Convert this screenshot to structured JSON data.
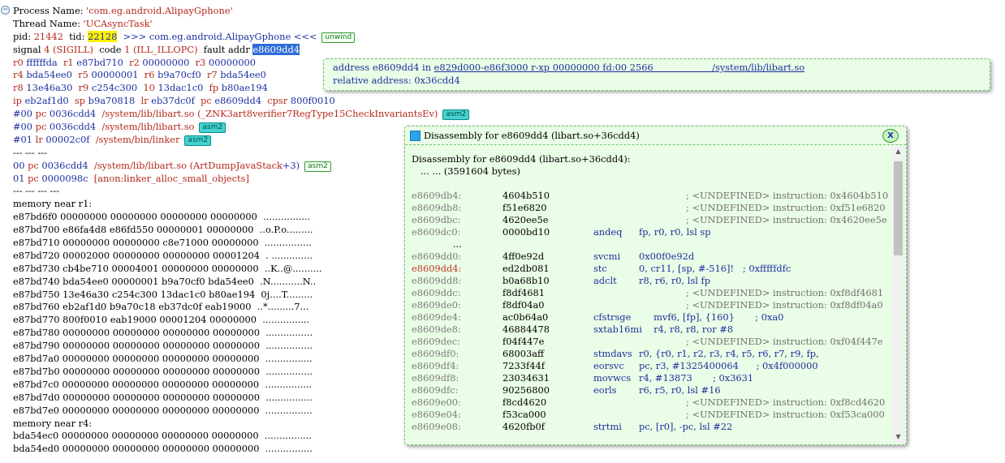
{
  "log": {
    "process_label": "Process Name: ",
    "process_name": "'com.eg.android.AlipayGphone'",
    "thread_label": "Thread Name: ",
    "thread_name": "'UCAsyncTask'",
    "pid_label": "pid: ",
    "pid": "21442",
    "tid_label": "  tid: ",
    "tid": "22128",
    "proc_marker": "  >>> com.eg.android.AlipayGphone <<<",
    "unwind_tag": "unwind",
    "signal_label": "signal ",
    "signal_num": "4",
    "signal_name": " (SIGILL)",
    "code_label": "  code ",
    "code_num": "1",
    "code_name": " (ILL_ILLOPC)",
    "fault_label": "  fault addr ",
    "fault_addr": "e8609dd4",
    "regs": [
      [
        [
          "r0",
          "ffffffda"
        ],
        [
          "r1",
          "e87bd710"
        ],
        [
          "r2",
          "00000000"
        ],
        [
          "r3",
          "00000000"
        ]
      ],
      [
        [
          "r4",
          "bda54ee0"
        ],
        [
          "r5",
          "00000001"
        ],
        [
          "r6",
          "b9a70cf0"
        ],
        [
          "r7",
          "bda54ee0"
        ]
      ],
      [
        [
          "r8",
          "13e46a30"
        ],
        [
          "r9",
          "c254c300"
        ],
        [
          "10",
          "13dac1c0"
        ],
        [
          "fp",
          "b80ae194"
        ]
      ],
      [
        [
          "ip",
          "eb2af1d0"
        ],
        [
          "sp",
          "b9a70818"
        ],
        [
          "lr",
          "eb37dc0f"
        ],
        [
          "pc",
          "e8609dd4"
        ],
        [
          "cpsr",
          "800f0010"
        ]
      ]
    ],
    "bt1": [
      {
        "idx": "#00",
        "reg": "pc",
        "addr": "0036cdd4",
        "lib": "/system/lib/libart.so",
        "sym": "(_ZNK3art8verifier7RegType15CheckInvariantsEv)",
        "tag": "asm2"
      },
      {
        "idx": "#00",
        "reg": "pc",
        "addr": "0036cdd4",
        "lib": "/system/lib/libart.so",
        "sym": "",
        "tag": "asm2"
      },
      {
        "idx": "#01",
        "reg": "lr",
        "addr": "00002c0f",
        "lib": "/system/bin/linker",
        "sym": "",
        "tag": "asm2"
      }
    ],
    "sep1": "--- --- ---",
    "bt2": [
      {
        "idx": "00",
        "reg": "pc",
        "addr": "0036cdd4",
        "lib": "/system/lib/libart.so",
        "sym": "(ArtDumpJavaStack",
        "offset": "+3)",
        "tag": "asm2"
      },
      {
        "idx": "01",
        "reg": "pc",
        "addr": "0000098c",
        "lib": "[anon:linker_alloc_small_objects]",
        "sym": "",
        "offset": "",
        "tag": ""
      }
    ],
    "sep2": "--- --- --- ---",
    "mem_r1_label": "memory near r1:",
    "mem_r1": [
      "e87bd6f0 00000000 00000000 00000000 00000000  ................",
      "e87bd700 e86fa4d8 e86fd550 00000001 00000000  ..o.P.o.........",
      "e87bd710 00000000 00000000 c8e71000 00000000  ................",
      "e87bd720 00002000 00000000 00000000 00001204  . ..............",
      "e87bd730 cb4be710 00004001 00000000 00000000  ..K..@..........",
      "e87bd740 bda54ee0 00000001 b9a70cf0 bda54ee0  .N...........N..",
      "e87bd750 13e46a30 c254c300 13dac1c0 b80ae194  0j....T.........",
      "e87bd760 eb2af1d0 b9a70c18 eb37dc0f eab19000  ..*.........7...",
      "e87bd770 800f0010 eab19000 00001204 00000000  ................",
      "e87bd780 00000000 00000000 00000000 00000000  ................",
      "e87bd790 00000000 00000000 00000000 00000000  ................",
      "e87bd7a0 00000000 00000000 00000000 00000000  ................",
      "e87bd7b0 00000000 00000000 00000000 00000000  ................",
      "e87bd7c0 00000000 00000000 00000000 00000000  ................",
      "e87bd7d0 00000000 00000000 00000000 00000000  ................",
      "e87bd7e0 00000000 00000000 00000000 00000000  ................"
    ],
    "mem_r4_label": "memory near r4:",
    "mem_r4": [
      "bda54ec0 00000000 00000000 00000000 00000000  ................",
      "bda54ed0 00000000 00000000 00000000 00000000  ................"
    ]
  },
  "tooltip": {
    "address_prefix": "address e8609dd4 in ",
    "range_link": "e829d000-e86f3000 r-xp 00000000 fd:00 2566                    /system/lib/libart.so",
    "relative": "relative address: 0x36cdd4"
  },
  "disasm": {
    "title": "Disassembly for e8609dd4 (libart.so+36cdd4)",
    "close_label": "X",
    "header": "Disassembly for e8609dd4 (libart.so+36cdd4):",
    "subheader": "   ... ... (3591604 bytes)",
    "ellipsis": "   ...",
    "rows": [
      {
        "addr": "e8609db4:",
        "hex": "4604b510",
        "mn": "",
        "op": "",
        "cmt": "; <UNDEFINED> instruction: 0x4604b510"
      },
      {
        "addr": "e8609db8:",
        "hex": "f51e6820",
        "mn": "",
        "op": "",
        "cmt": "; <UNDEFINED> instruction: 0xf51e6820"
      },
      {
        "addr": "e8609dbc:",
        "hex": "4620ee5e",
        "mn": "",
        "op": "",
        "cmt": "; <UNDEFINED> instruction: 0x4620ee5e"
      },
      {
        "addr": "e8609dc0:",
        "hex": "0000bd10",
        "mn": "andeq",
        "op": "fp, r0, r0, lsl sp",
        "cmt": ""
      },
      {
        "addr": "e8609dd0:",
        "hex": "4ff0e92d",
        "mn": "svcmi",
        "op": "0x00f0e92d",
        "cmt": ""
      },
      {
        "addr": "e8609dd4:",
        "hex": "ed2db081",
        "mn": "stc",
        "op": "0, cr11, [sp, #-516]!   ; 0xfffffdfc",
        "cmt": "",
        "current": true
      },
      {
        "addr": "e8609dd8:",
        "hex": "b0a68b10",
        "mn": "adclt",
        "op": "r8, r6, r0, lsl fp",
        "cmt": ""
      },
      {
        "addr": "e8609ddc:",
        "hex": "f8df4681",
        "mn": "",
        "op": "",
        "cmt": "; <UNDEFINED> instruction: 0xf8df4681"
      },
      {
        "addr": "e8609de0:",
        "hex": "f8df04a0",
        "mn": "",
        "op": "",
        "cmt": "; <UNDEFINED> instruction: 0xf8df04a0"
      },
      {
        "addr": "e8609de4:",
        "hex": "ac0b64a0",
        "mn": "cfstrsge",
        "op": "     mvf6, [fp], {160}       ; 0xa0",
        "cmt": ""
      },
      {
        "addr": "e8609de8:",
        "hex": "46884478",
        "mn": "sxtab16mi",
        "op": "     r4, r8, r8, ror #8",
        "cmt": ""
      },
      {
        "addr": "e8609dec:",
        "hex": "f04f447e",
        "mn": "",
        "op": "",
        "cmt": "; <UNDEFINED> instruction: 0xf04f447e"
      },
      {
        "addr": "e8609df0:",
        "hex": "68003aff",
        "mn": "stmdavs",
        "op": "r0, {r0, r1, r2, r3, r4, r5, r6, r7, r9, fp,",
        "cmt": ""
      },
      {
        "addr": "e8609df4:",
        "hex": "7233f44f",
        "mn": "eorsvc",
        "op": "pc, r3, #1325400064      ; 0x4f000000",
        "cmt": ""
      },
      {
        "addr": "e8609df8:",
        "hex": "23034631",
        "mn": "movwcs",
        "op": "r4, #13873       ; 0x3631",
        "cmt": ""
      },
      {
        "addr": "e8609dfc:",
        "hex": "90256800",
        "mn": "eorls",
        "op": "r6, r5, r0, lsl #16",
        "cmt": ""
      },
      {
        "addr": "e8609e00:",
        "hex": "f8cd4620",
        "mn": "",
        "op": "",
        "cmt": "; <UNDEFINED> instruction: 0xf8cd4620"
      },
      {
        "addr": "e8609e04:",
        "hex": "f53ca000",
        "mn": "",
        "op": "",
        "cmt": "; <UNDEFINED> instruction: 0xf53ca000"
      },
      {
        "addr": "e8609e08:",
        "hex": "4620fb0f",
        "mn": "strtmi",
        "op": "pc, [r0], -pc, lsl #22",
        "cmt": ""
      }
    ]
  },
  "colors": {
    "yellow_highlight": "#fff200",
    "selection": "#2f6cd8",
    "popup_bg": "#eafde6",
    "tag_teal": "#43d3d0"
  }
}
